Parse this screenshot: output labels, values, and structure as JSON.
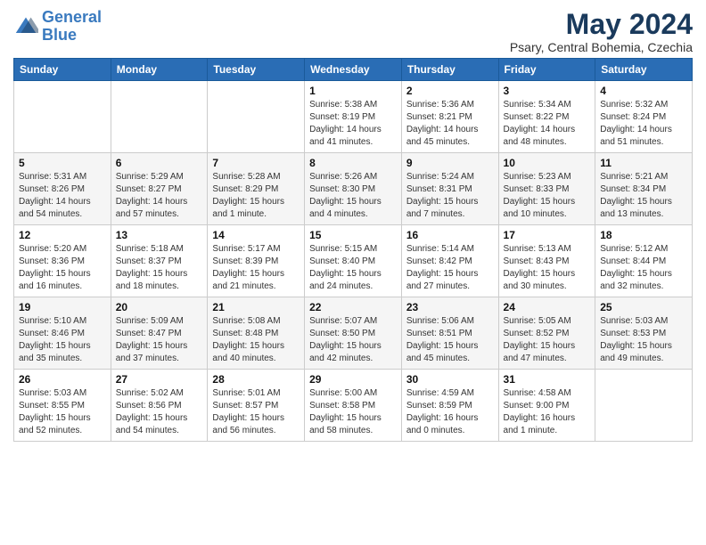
{
  "logo": {
    "line1": "General",
    "line2": "Blue"
  },
  "title": "May 2024",
  "subtitle": "Psary, Central Bohemia, Czechia",
  "weekdays": [
    "Sunday",
    "Monday",
    "Tuesday",
    "Wednesday",
    "Thursday",
    "Friday",
    "Saturday"
  ],
  "weeks": [
    [
      {
        "day": "",
        "sunrise": "",
        "sunset": "",
        "daylight": ""
      },
      {
        "day": "",
        "sunrise": "",
        "sunset": "",
        "daylight": ""
      },
      {
        "day": "",
        "sunrise": "",
        "sunset": "",
        "daylight": ""
      },
      {
        "day": "1",
        "sunrise": "Sunrise: 5:38 AM",
        "sunset": "Sunset: 8:19 PM",
        "daylight": "Daylight: 14 hours and 41 minutes."
      },
      {
        "day": "2",
        "sunrise": "Sunrise: 5:36 AM",
        "sunset": "Sunset: 8:21 PM",
        "daylight": "Daylight: 14 hours and 45 minutes."
      },
      {
        "day": "3",
        "sunrise": "Sunrise: 5:34 AM",
        "sunset": "Sunset: 8:22 PM",
        "daylight": "Daylight: 14 hours and 48 minutes."
      },
      {
        "day": "4",
        "sunrise": "Sunrise: 5:32 AM",
        "sunset": "Sunset: 8:24 PM",
        "daylight": "Daylight: 14 hours and 51 minutes."
      }
    ],
    [
      {
        "day": "5",
        "sunrise": "Sunrise: 5:31 AM",
        "sunset": "Sunset: 8:26 PM",
        "daylight": "Daylight: 14 hours and 54 minutes."
      },
      {
        "day": "6",
        "sunrise": "Sunrise: 5:29 AM",
        "sunset": "Sunset: 8:27 PM",
        "daylight": "Daylight: 14 hours and 57 minutes."
      },
      {
        "day": "7",
        "sunrise": "Sunrise: 5:28 AM",
        "sunset": "Sunset: 8:29 PM",
        "daylight": "Daylight: 15 hours and 1 minute."
      },
      {
        "day": "8",
        "sunrise": "Sunrise: 5:26 AM",
        "sunset": "Sunset: 8:30 PM",
        "daylight": "Daylight: 15 hours and 4 minutes."
      },
      {
        "day": "9",
        "sunrise": "Sunrise: 5:24 AM",
        "sunset": "Sunset: 8:31 PM",
        "daylight": "Daylight: 15 hours and 7 minutes."
      },
      {
        "day": "10",
        "sunrise": "Sunrise: 5:23 AM",
        "sunset": "Sunset: 8:33 PM",
        "daylight": "Daylight: 15 hours and 10 minutes."
      },
      {
        "day": "11",
        "sunrise": "Sunrise: 5:21 AM",
        "sunset": "Sunset: 8:34 PM",
        "daylight": "Daylight: 15 hours and 13 minutes."
      }
    ],
    [
      {
        "day": "12",
        "sunrise": "Sunrise: 5:20 AM",
        "sunset": "Sunset: 8:36 PM",
        "daylight": "Daylight: 15 hours and 16 minutes."
      },
      {
        "day": "13",
        "sunrise": "Sunrise: 5:18 AM",
        "sunset": "Sunset: 8:37 PM",
        "daylight": "Daylight: 15 hours and 18 minutes."
      },
      {
        "day": "14",
        "sunrise": "Sunrise: 5:17 AM",
        "sunset": "Sunset: 8:39 PM",
        "daylight": "Daylight: 15 hours and 21 minutes."
      },
      {
        "day": "15",
        "sunrise": "Sunrise: 5:15 AM",
        "sunset": "Sunset: 8:40 PM",
        "daylight": "Daylight: 15 hours and 24 minutes."
      },
      {
        "day": "16",
        "sunrise": "Sunrise: 5:14 AM",
        "sunset": "Sunset: 8:42 PM",
        "daylight": "Daylight: 15 hours and 27 minutes."
      },
      {
        "day": "17",
        "sunrise": "Sunrise: 5:13 AM",
        "sunset": "Sunset: 8:43 PM",
        "daylight": "Daylight: 15 hours and 30 minutes."
      },
      {
        "day": "18",
        "sunrise": "Sunrise: 5:12 AM",
        "sunset": "Sunset: 8:44 PM",
        "daylight": "Daylight: 15 hours and 32 minutes."
      }
    ],
    [
      {
        "day": "19",
        "sunrise": "Sunrise: 5:10 AM",
        "sunset": "Sunset: 8:46 PM",
        "daylight": "Daylight: 15 hours and 35 minutes."
      },
      {
        "day": "20",
        "sunrise": "Sunrise: 5:09 AM",
        "sunset": "Sunset: 8:47 PM",
        "daylight": "Daylight: 15 hours and 37 minutes."
      },
      {
        "day": "21",
        "sunrise": "Sunrise: 5:08 AM",
        "sunset": "Sunset: 8:48 PM",
        "daylight": "Daylight: 15 hours and 40 minutes."
      },
      {
        "day": "22",
        "sunrise": "Sunrise: 5:07 AM",
        "sunset": "Sunset: 8:50 PM",
        "daylight": "Daylight: 15 hours and 42 minutes."
      },
      {
        "day": "23",
        "sunrise": "Sunrise: 5:06 AM",
        "sunset": "Sunset: 8:51 PM",
        "daylight": "Daylight: 15 hours and 45 minutes."
      },
      {
        "day": "24",
        "sunrise": "Sunrise: 5:05 AM",
        "sunset": "Sunset: 8:52 PM",
        "daylight": "Daylight: 15 hours and 47 minutes."
      },
      {
        "day": "25",
        "sunrise": "Sunrise: 5:03 AM",
        "sunset": "Sunset: 8:53 PM",
        "daylight": "Daylight: 15 hours and 49 minutes."
      }
    ],
    [
      {
        "day": "26",
        "sunrise": "Sunrise: 5:03 AM",
        "sunset": "Sunset: 8:55 PM",
        "daylight": "Daylight: 15 hours and 52 minutes."
      },
      {
        "day": "27",
        "sunrise": "Sunrise: 5:02 AM",
        "sunset": "Sunset: 8:56 PM",
        "daylight": "Daylight: 15 hours and 54 minutes."
      },
      {
        "day": "28",
        "sunrise": "Sunrise: 5:01 AM",
        "sunset": "Sunset: 8:57 PM",
        "daylight": "Daylight: 15 hours and 56 minutes."
      },
      {
        "day": "29",
        "sunrise": "Sunrise: 5:00 AM",
        "sunset": "Sunset: 8:58 PM",
        "daylight": "Daylight: 15 hours and 58 minutes."
      },
      {
        "day": "30",
        "sunrise": "Sunrise: 4:59 AM",
        "sunset": "Sunset: 8:59 PM",
        "daylight": "Daylight: 16 hours and 0 minutes."
      },
      {
        "day": "31",
        "sunrise": "Sunrise: 4:58 AM",
        "sunset": "Sunset: 9:00 PM",
        "daylight": "Daylight: 16 hours and 1 minute."
      },
      {
        "day": "",
        "sunrise": "",
        "sunset": "",
        "daylight": ""
      }
    ]
  ]
}
